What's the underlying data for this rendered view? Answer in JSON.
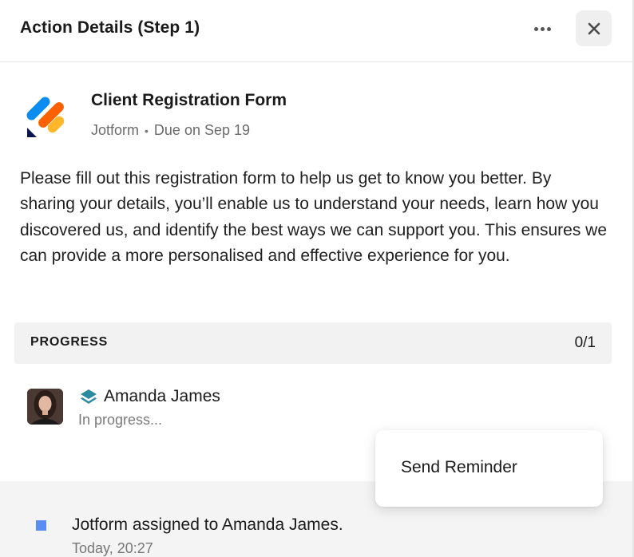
{
  "header": {
    "title": "Action Details (Step 1)",
    "more_icon": "ellipsis-icon",
    "close_icon": "close-icon"
  },
  "form": {
    "title": "Client Registration Form",
    "app_name": "Jotform",
    "separator": "•",
    "due": "Due on Sep 19",
    "logo_icon": "jotform-logo"
  },
  "description": "Please fill out this registration form to help us get to know you better. By sharing your details, you’ll enable us to understand your needs, learn how you discovered us, and identify the best ways we can support you. This ensures we can provide a more personalised and effective experience for you.",
  "progress": {
    "label": "PROGRESS",
    "count": "0/1",
    "completed": 0,
    "total": 1
  },
  "assignee": {
    "name": "Amanda James",
    "status": "In progress...",
    "avatar": "user-avatar",
    "icon": "layers-icon"
  },
  "activity": {
    "text": "Jotform assigned to Amanda James.",
    "time": "Today, 20:27"
  },
  "menu": {
    "items": [
      "Send Reminder"
    ]
  },
  "colors": {
    "accent_blue": "#5a8ef0",
    "logo_blue": "#0a8cf0",
    "logo_orange": "#ff6100",
    "logo_yellow": "#ffb629",
    "logo_navy": "#0a1551",
    "layers_teal": "#2a8aa0"
  }
}
